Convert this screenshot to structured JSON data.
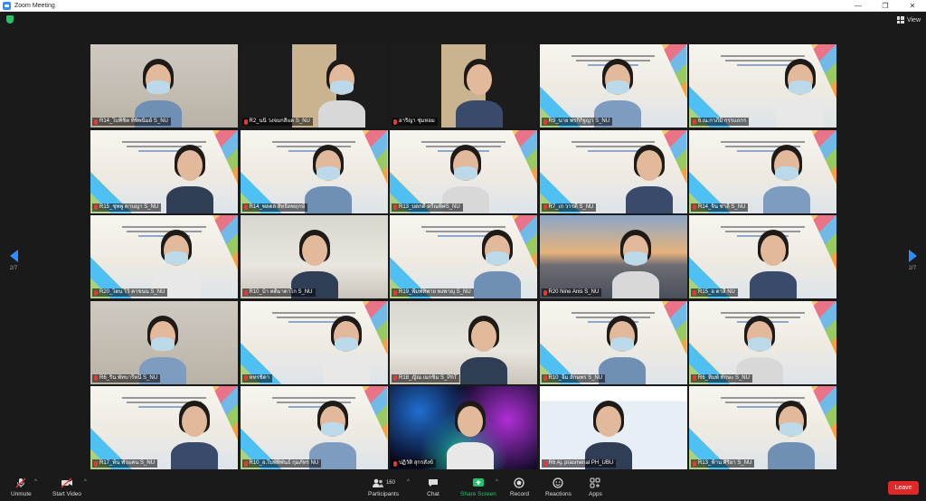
{
  "window": {
    "title": "Zoom Meeting",
    "minimize": "—",
    "maximize": "❐",
    "close": "✕"
  },
  "view_button": {
    "label": "View"
  },
  "pagination": {
    "left": "2/7",
    "right": "2/7"
  },
  "tiles": [
    {
      "name": "R14_ไบพิชิต ทิพิพนิมย์ S_NU",
      "scene": "room"
    },
    {
      "name": "R2_นนิ วงจมกสิแต S_NU",
      "scene": "dark-warm"
    },
    {
      "name": "อาริญา ชุ่มหอม",
      "scene": "dark-warm"
    },
    {
      "name": "R9_นาย พรกิกิฐญา S_NU",
      "scene": "banner"
    },
    {
      "name": "6 ณ.กาภีมิ กรรแถกร",
      "scene": "banner"
    },
    {
      "name": "R15_ชุพพู ดาบญา S_NU",
      "scene": "banner"
    },
    {
      "name": "R14_พลดล สิทธิตพฤกษ์",
      "scene": "banner"
    },
    {
      "name": "R13_บดกดี ตรีณพิศS_NU",
      "scene": "banner"
    },
    {
      "name": "R7_เก วารดี S_NU",
      "scene": "banner"
    },
    {
      "name": "R14_จิน ชาลี S_NU",
      "scene": "banner"
    },
    {
      "name": "R20_ไดน ไวิ คาขนน S_NU",
      "scene": "banner"
    },
    {
      "name": "R10_บ้า คติมาดา์ไก S_NU",
      "scene": "wall"
    },
    {
      "name": "R19_พีมพ์ทิพาย พงพาญุ S_NU",
      "scene": "banner"
    },
    {
      "name": "R20 Nine Anis S_NU",
      "scene": "sky"
    },
    {
      "name": "R15_อ ตาลี NU",
      "scene": "banner"
    },
    {
      "name": "R6_ริน พัทบารีหนี S_NU",
      "scene": "room"
    },
    {
      "name": "หทรชิดา",
      "scene": "banner"
    },
    {
      "name": "R18_ญิณ เมกขิ่ม S_PhT",
      "scene": "wall"
    },
    {
      "name": "R10_จีม ลักษพร S_NU",
      "scene": "banner"
    },
    {
      "name": "R6_ทิมพ์ ทักษะ S_NU",
      "scene": "banner"
    },
    {
      "name": "R17_ห้น พัวแคน S_NU",
      "scene": "banner"
    },
    {
      "name": "R10_อ.ใบพัพิพันธ์ กุมภัทร NU",
      "scene": "banner"
    },
    {
      "name": "ปฏิวัติ สุกรสังข์",
      "scene": "neon"
    },
    {
      "name": "R6 Aj. prasmenal PH_UBU",
      "scene": "slide"
    },
    {
      "name": "R13_ฟ้าน ศิริยา S_NU",
      "scene": "banner"
    }
  ],
  "toolbar": {
    "unmute": "Unmute",
    "start_video": "Start Video",
    "participants": "Participants",
    "participants_count": "160",
    "chat": "Chat",
    "share_screen": "Share Screen",
    "record": "Record",
    "reactions": "Reactions",
    "apps": "Apps",
    "leave": "Leave"
  },
  "colors": {
    "accent": "#2d8cff",
    "share": "#23c26b",
    "leave": "#e02828",
    "muted_mic": "#e53935",
    "background": "#1a1a1a"
  }
}
